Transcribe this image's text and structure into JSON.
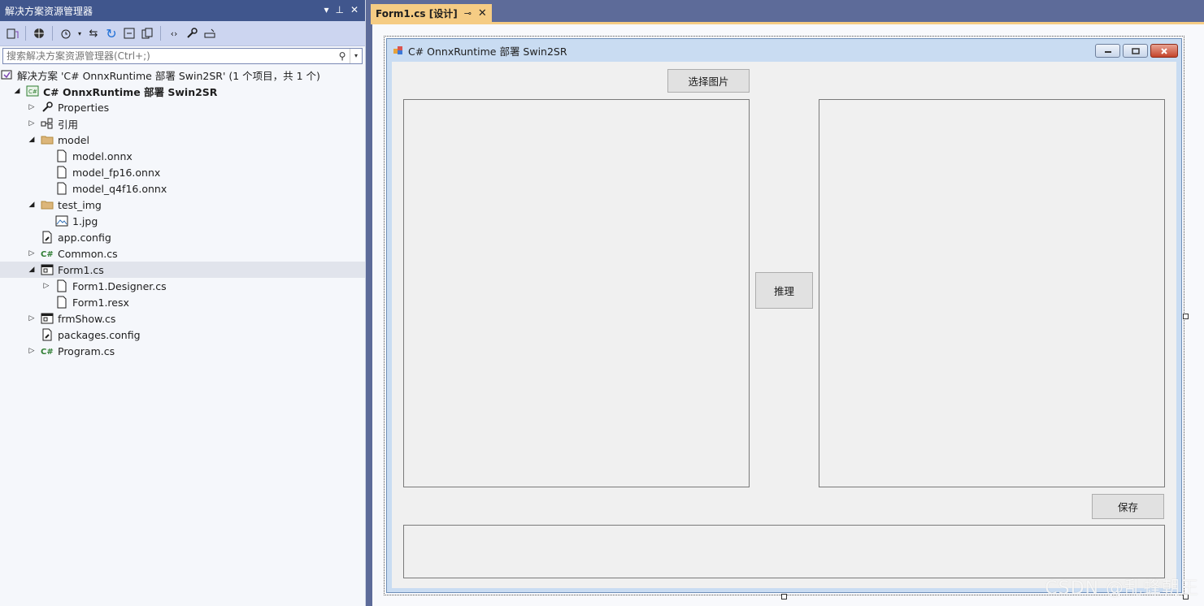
{
  "solution_explorer": {
    "title": "解决方案资源管理器",
    "title_buttons": [
      "▾",
      "⊥",
      "✕"
    ],
    "search_placeholder": "搜索解决方案资源管理器(Ctrl+;)",
    "tree": [
      {
        "label": "解决方案 'C# OnnxRuntime 部署 Swin2SR' (1 个项目，共 1 个)",
        "icon": "solution-icon",
        "depth": 0,
        "expander": "",
        "bold": false
      },
      {
        "label": "C# OnnxRuntime 部署 Swin2SR",
        "icon": "csharp-project-icon",
        "depth": 1,
        "expander": "◢",
        "bold": true
      },
      {
        "label": "Properties",
        "icon": "wrench-icon",
        "depth": 2,
        "expander": "▷",
        "bold": false
      },
      {
        "label": "引用",
        "icon": "references-icon",
        "depth": 2,
        "expander": "▷",
        "bold": false
      },
      {
        "label": "model",
        "icon": "folder-icon",
        "depth": 2,
        "expander": "◢",
        "bold": false
      },
      {
        "label": "model.onnx",
        "icon": "file-icon",
        "depth": 3,
        "expander": "",
        "bold": false
      },
      {
        "label": "model_fp16.onnx",
        "icon": "file-icon",
        "depth": 3,
        "expander": "",
        "bold": false
      },
      {
        "label": "model_q4f16.onnx",
        "icon": "file-icon",
        "depth": 3,
        "expander": "",
        "bold": false
      },
      {
        "label": "test_img",
        "icon": "folder-icon",
        "depth": 2,
        "expander": "◢",
        "bold": false
      },
      {
        "label": "1.jpg",
        "icon": "image-file-icon",
        "depth": 3,
        "expander": "",
        "bold": false
      },
      {
        "label": "app.config",
        "icon": "config-file-icon",
        "depth": 2,
        "expander": "",
        "bold": false
      },
      {
        "label": "Common.cs",
        "icon": "csharp-file-icon",
        "depth": 2,
        "expander": "▷",
        "bold": false
      },
      {
        "label": "Form1.cs",
        "icon": "form-icon",
        "depth": 2,
        "expander": "◢",
        "bold": false,
        "selected": true
      },
      {
        "label": "Form1.Designer.cs",
        "icon": "file-icon",
        "depth": 3,
        "expander": "▷",
        "bold": false
      },
      {
        "label": "Form1.resx",
        "icon": "file-icon",
        "depth": 3,
        "expander": "",
        "bold": false
      },
      {
        "label": "frmShow.cs",
        "icon": "form-icon",
        "depth": 2,
        "expander": "▷",
        "bold": false
      },
      {
        "label": "packages.config",
        "icon": "config-file-icon",
        "depth": 2,
        "expander": "",
        "bold": false
      },
      {
        "label": "Program.cs",
        "icon": "csharp-file-icon",
        "depth": 2,
        "expander": "▷",
        "bold": false
      }
    ]
  },
  "editor": {
    "tab_label": "Form1.cs [设计]",
    "tab_pin": "⊸",
    "tab_close": "✕"
  },
  "form": {
    "title": "C# OnnxRuntime 部署 Swin2SR",
    "select_image_label": "选择图片",
    "infer_label": "推理",
    "save_label": "保存"
  },
  "watermark": "CSDN @乱蜂朝王",
  "colors": {
    "title_bar": "#40568d",
    "toolbar": "#ccd5f0",
    "tab_active": "#f5cc84",
    "ide_background": "#5d6b99",
    "form_client": "#f0f0f0"
  }
}
